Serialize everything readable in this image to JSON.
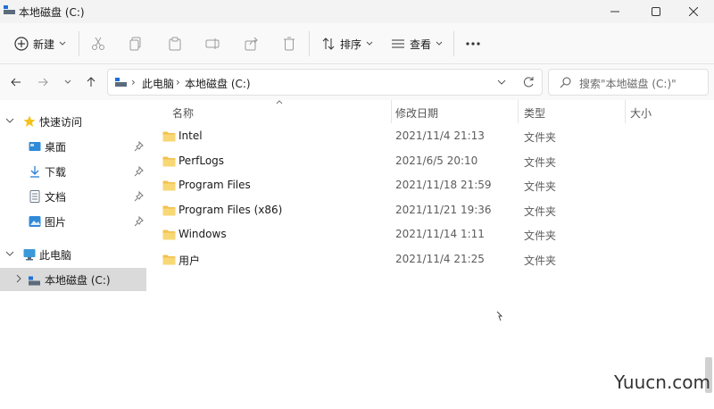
{
  "window": {
    "title": "本地磁盘 (C:)",
    "title_icon": "drive-icon",
    "controls": [
      "minimize-icon",
      "maximize-icon",
      "close-icon"
    ]
  },
  "toolbar": {
    "new_label": "新建",
    "sort_label": "排序",
    "view_label": "查看",
    "icons": [
      "cut-icon",
      "copy-icon",
      "paste-icon",
      "rename-icon",
      "share-icon",
      "delete-icon",
      "more-icon"
    ]
  },
  "address": {
    "crumbs": [
      "此电脑",
      "本地磁盘 (C:)"
    ],
    "search_placeholder": "搜索\"本地磁盘 (C:)\""
  },
  "sidebar": {
    "quick_access": "快速访问",
    "items": [
      {
        "label": "桌面",
        "icon": "desktop-icon"
      },
      {
        "label": "下载",
        "icon": "download-icon"
      },
      {
        "label": "文档",
        "icon": "documents-icon"
      },
      {
        "label": "图片",
        "icon": "pictures-icon"
      }
    ],
    "this_pc": "此电脑",
    "drive": "本地磁盘 (C:)"
  },
  "columns": {
    "name": "名称",
    "date": "修改日期",
    "type": "类型",
    "size": "大小"
  },
  "files": [
    {
      "name": "Intel",
      "date": "2021/11/4 21:13",
      "type": "文件夹"
    },
    {
      "name": "PerfLogs",
      "date": "2021/6/5 20:10",
      "type": "文件夹"
    },
    {
      "name": "Program Files",
      "date": "2021/11/18 21:59",
      "type": "文件夹"
    },
    {
      "name": "Program Files (x86)",
      "date": "2021/11/21 19:36",
      "type": "文件夹"
    },
    {
      "name": "Windows",
      "date": "2021/11/14 1:11",
      "type": "文件夹"
    },
    {
      "name": "用户",
      "date": "2021/11/4 21:25",
      "type": "文件夹"
    }
  ],
  "watermark": "Yuucn.com",
  "colors": {
    "accent": "#0067c0",
    "folder": "#f2c14e",
    "selected": "#dadada"
  }
}
